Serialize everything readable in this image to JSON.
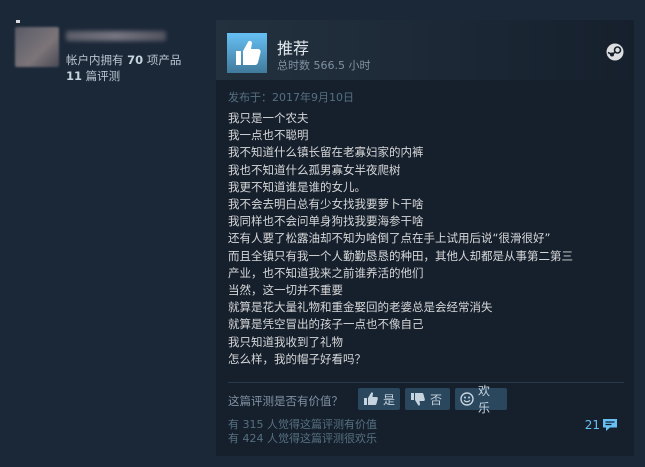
{
  "author": {
    "owned_label_prefix": "帐户内拥有 ",
    "owned_count": "70",
    "owned_label_suffix": " 项产品",
    "reviews_count": "11",
    "reviews_label": " 篇评测"
  },
  "review": {
    "recommendation": "推荐",
    "hours": "总时数 566.5 小时",
    "posted": "发布于：2017年9月10日",
    "lines": [
      "我只是一个农夫",
      "我一点也不聪明",
      "我不知道什么镇长留在老寡妇家的内裤",
      "我也不知道什么孤男寡女半夜爬树",
      "我更不知道谁是谁的女儿。",
      "我不会去明白总有少女找我要萝卜干啥",
      "我同样也不会问单身狗找我要海参干啥",
      "还有人要了松露油却不知为啥倒了点在手上试用后说“很滑很好”",
      "而且全镇只有我一个人勤勤恳恳的种田，其他人却都是从事第二第三",
      "产业，也不知道我来之前谁养活的他们",
      "当然，这一切并不重要",
      "就算是花大量礼物和重金娶回的老婆总是会经常消失",
      "就算是凭空冒出的孩子一点也不像自己",
      "我只知道我收到了礼物",
      "怎么样，我的帽子好看吗？"
    ]
  },
  "feedback": {
    "question": "这篇评测是否有价值？",
    "yes_label": "是",
    "no_label": "否",
    "funny_label": "欢乐",
    "helpful_stat": "有 315 人觉得这篇评测有价值",
    "funny_stat": "有 424 人觉得这篇评测很欢乐",
    "comment_count": "21"
  },
  "icons": {
    "recommend": "thumbs-up-icon",
    "platform": "steam-icon",
    "yes": "thumbs-up-icon",
    "no": "thumbs-down-icon",
    "funny": "smiley-icon",
    "comments": "comment-bubble-icon"
  },
  "colors": {
    "page_bg": "#1b2838",
    "panel_bg": "#16202d",
    "accent": "#66c0f4",
    "button_bg": "#2a475e",
    "text": "#d6d7d8"
  }
}
